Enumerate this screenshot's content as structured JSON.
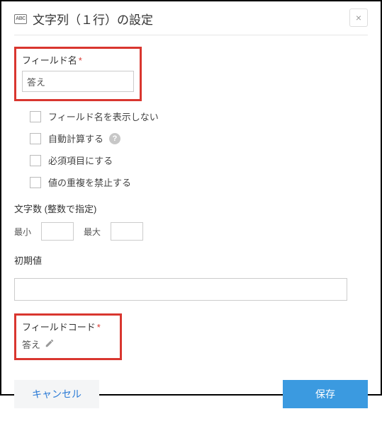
{
  "header": {
    "icon_text": "ABC",
    "title": "文字列（１行）の設定",
    "close_glyph": "×"
  },
  "field_name": {
    "label": "フィールド名",
    "required_mark": "*",
    "value": "答え"
  },
  "options": {
    "hide_label": "フィールド名を表示しない",
    "auto_calc": "自動計算する",
    "help_glyph": "?",
    "required": "必須項目にする",
    "unique": "値の重複を禁止する"
  },
  "char_count": {
    "label": "文字数 (整数で指定)",
    "min_label": "最小",
    "max_label": "最大"
  },
  "initial_value": {
    "label": "初期値"
  },
  "field_code": {
    "label": "フィールドコード",
    "required_mark": "*",
    "value": "答え"
  },
  "footer": {
    "cancel": "キャンセル",
    "save": "保存"
  }
}
